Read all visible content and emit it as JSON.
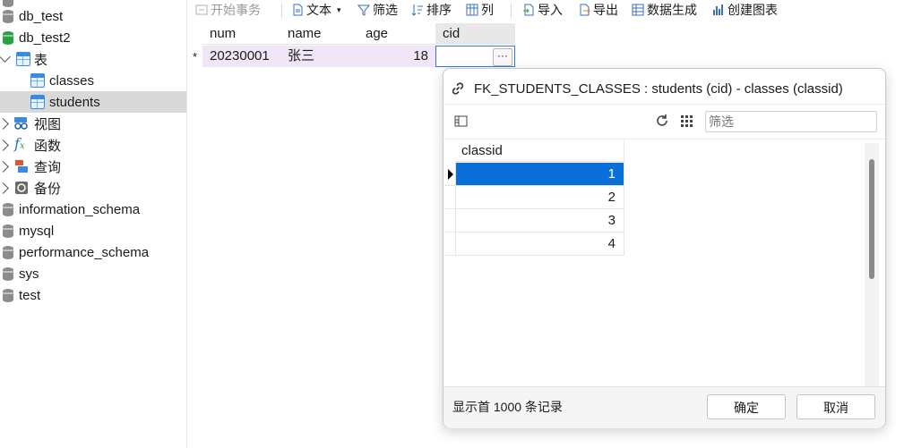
{
  "sidebar": {
    "items": [
      {
        "label": "db_test"
      },
      {
        "label": "db_test2"
      },
      {
        "label": "表"
      },
      {
        "label": "classes"
      },
      {
        "label": "students"
      },
      {
        "label": "视图"
      },
      {
        "label": "函数"
      },
      {
        "label": "查询"
      },
      {
        "label": "备份"
      },
      {
        "label": "information_schema"
      },
      {
        "label": "mysql"
      },
      {
        "label": "performance_schema"
      },
      {
        "label": "sys"
      },
      {
        "label": "test"
      }
    ]
  },
  "toolbar": {
    "begin_transaction": "开始事务",
    "text": "文本",
    "filter": "筛选",
    "sort": "排序",
    "columns": "列",
    "import": "导入",
    "export": "导出",
    "generate_data": "数据生成",
    "create_chart": "创建图表"
  },
  "grid": {
    "columns": [
      "num",
      "name",
      "age",
      "cid"
    ],
    "row_marker": "*",
    "row": {
      "num": "20230001",
      "name": "张三",
      "age": "18",
      "cid": ""
    },
    "ellipsis": "···"
  },
  "popup": {
    "title": "FK_STUDENTS_CLASSES : students (cid) - classes (classid)",
    "filter_placeholder": "筛选",
    "column": "classid",
    "rows": [
      "1",
      "2",
      "3",
      "4"
    ],
    "selected_index": 0,
    "footer_text": "显示首 1000 条记录",
    "ok_label": "确定",
    "cancel_label": "取消"
  }
}
